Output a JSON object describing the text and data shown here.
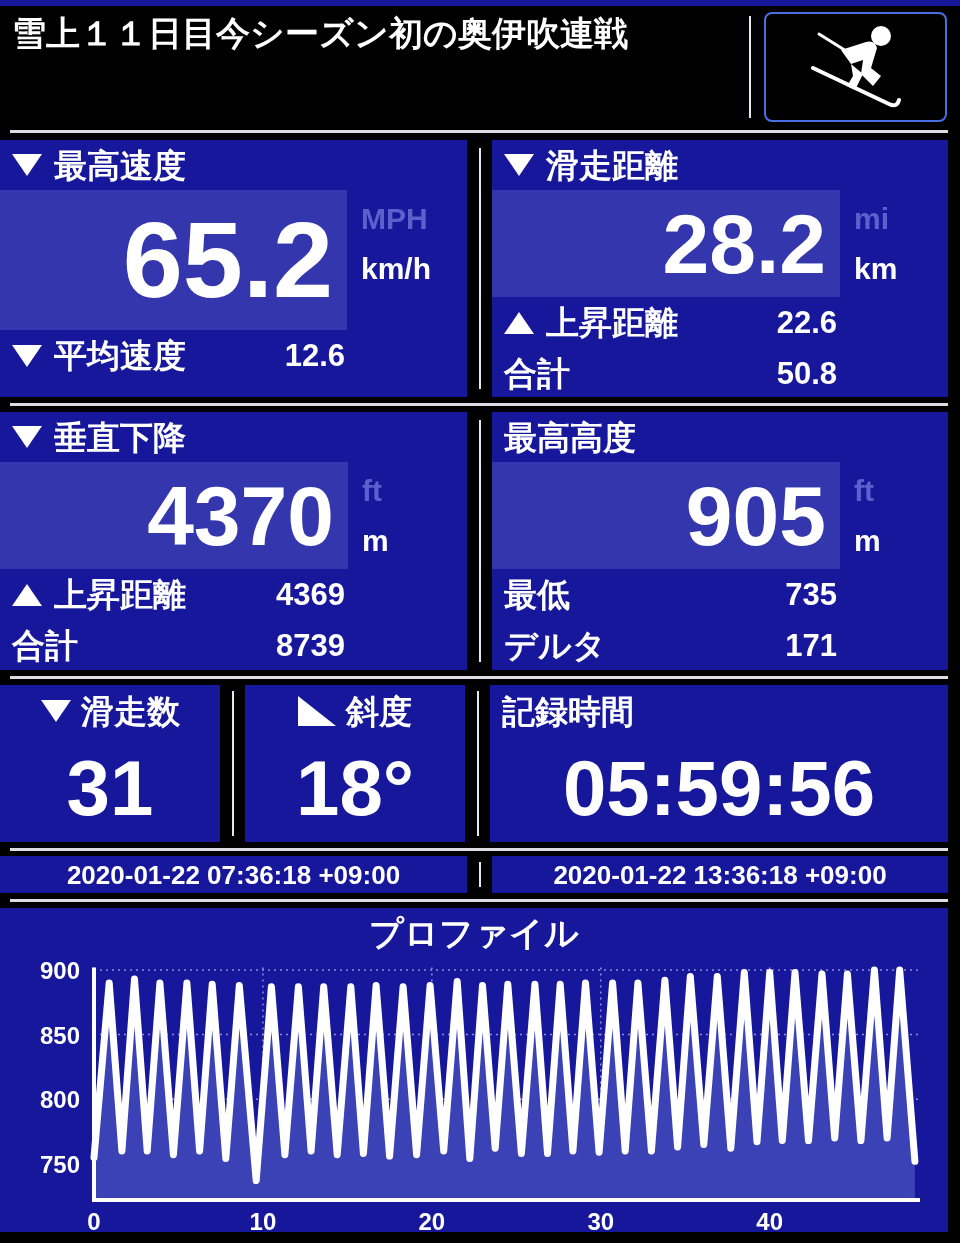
{
  "title": "雪上１１日目今シーズン初の奥伊吹連戦",
  "top_panels": [
    {
      "kind": "down",
      "label": "最高速度",
      "value": "65.2",
      "units": [
        {
          "text": "MPH",
          "selected": false
        },
        {
          "text": "km/h",
          "selected": true
        }
      ],
      "rows": [
        {
          "kind": "down",
          "label": "平均速度",
          "value": "12.6"
        }
      ]
    },
    {
      "kind": "down",
      "label": "滑走距離",
      "value": "28.2",
      "units": [
        {
          "text": "mi",
          "selected": false
        },
        {
          "text": "km",
          "selected": true
        }
      ],
      "rows": [
        {
          "kind": "up",
          "label": "上昇距離",
          "value": "22.6"
        },
        {
          "label": "合計",
          "value": "50.8"
        }
      ]
    },
    {
      "kind": "down",
      "label": "垂直下降",
      "value": "4370",
      "units": [
        {
          "text": "ft",
          "selected": false
        },
        {
          "text": "m",
          "selected": true
        }
      ],
      "rows": [
        {
          "kind": "up",
          "label": "上昇距離",
          "value": "4369"
        },
        {
          "label": "合計",
          "value": "8739"
        }
      ]
    },
    {
      "label": "最高高度",
      "value": "905",
      "units": [
        {
          "text": "ft",
          "selected": false
        },
        {
          "text": "m",
          "selected": true
        }
      ],
      "rows": [
        {
          "label": "最低",
          "value": "735"
        },
        {
          "label": "デルタ",
          "value": "171"
        }
      ]
    }
  ],
  "summary_panels": [
    {
      "kind": "down",
      "label": "滑走数",
      "value": "31"
    },
    {
      "kind": "slope",
      "label": "斜度",
      "value": "18°"
    },
    {
      "label": "記録時間",
      "value": "05:59:56"
    }
  ],
  "timestamps": [
    "2020-01-22 07:36:18 +09:00",
    "2020-01-22 13:36:18 +09:00"
  ],
  "profile": {
    "chart_data": {
      "type": "area",
      "title": "プロファイル",
      "grid": true,
      "x": [
        0,
        0.9,
        1.65,
        2.4,
        3.15,
        3.9,
        4.7,
        5.5,
        6.25,
        7.0,
        7.8,
        8.6,
        9.6,
        10.5,
        11.3,
        12.1,
        12.85,
        13.6,
        14.4,
        15.2,
        15.95,
        16.7,
        17.5,
        18.3,
        19.1,
        19.9,
        20.7,
        21.5,
        22.25,
        23.0,
        23.75,
        24.5,
        25.3,
        26.1,
        26.85,
        27.6,
        28.35,
        29.1,
        29.9,
        30.7,
        31.45,
        32.2,
        33.0,
        33.8,
        34.55,
        35.3,
        36.1,
        36.9,
        37.7,
        38.5,
        39.25,
        40.0,
        40.75,
        41.5,
        42.3,
        43.1,
        43.85,
        44.6,
        45.4,
        46.2,
        46.95,
        47.7,
        48.6
      ],
      "series": [
        {
          "color": "#ffffff",
          "values": [
            755,
            890,
            760,
            893,
            760,
            890,
            757,
            890,
            760,
            889,
            754,
            888,
            737,
            887,
            757,
            887,
            760,
            887,
            757,
            887,
            758,
            888,
            756,
            887,
            757,
            888,
            760,
            891,
            754,
            888,
            762,
            889,
            758,
            889,
            758,
            889,
            760,
            890,
            759,
            890,
            760,
            890,
            760,
            892,
            763,
            895,
            765,
            895,
            762,
            898,
            767,
            898,
            768,
            898,
            768,
            897,
            770,
            897,
            768,
            900,
            770,
            900,
            752
          ]
        }
      ],
      "xlim": [
        0,
        48.9
      ],
      "ylim": [
        722,
        902
      ],
      "xticks": [
        0,
        10,
        20,
        30,
        40
      ],
      "yticks": [
        750,
        800,
        850,
        900
      ]
    }
  }
}
